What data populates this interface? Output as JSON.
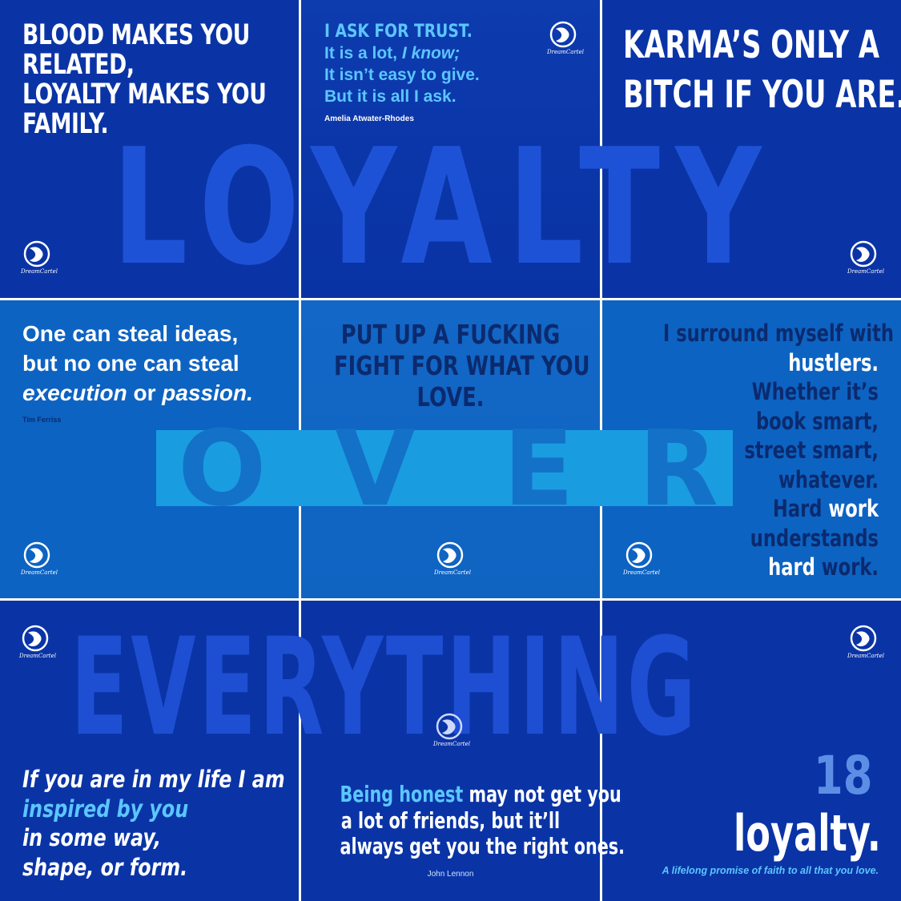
{
  "background": {
    "word_top": "LOYALTY",
    "word_middle": [
      "O",
      "V",
      "E",
      "R"
    ],
    "word_bottom": "EVERYTHING"
  },
  "brand": {
    "logo_text": "DreamCartel"
  },
  "tiles": {
    "t1": {
      "lines": [
        "BLOOD MAKES YOU",
        "RELATED,",
        "LOYALTY MAKES YOU",
        "FAMILY."
      ]
    },
    "t2": {
      "heading": "I ASK FOR TRUST.",
      "line2_a": "It is a lot, ",
      "line2_b": "I know;",
      "line3": "It isn’t easy to give.",
      "line4": "But it is all I ask.",
      "author": "Amelia Atwater-Rhodes"
    },
    "t3": {
      "lines": [
        "KARMA’S ONLY A",
        "BITCH IF YOU ARE."
      ]
    },
    "t4": {
      "line1": "One can steal ideas,",
      "line2": "but no one can steal",
      "line3_a": "execution",
      "line3_b": " or ",
      "line3_c": "passion.",
      "author": "Tim Ferriss"
    },
    "t5": {
      "lines": [
        "PUT UP A FUCKING",
        "FIGHT FOR WHAT YOU",
        "LOVE."
      ]
    },
    "t6": {
      "lines": [
        "I surround myself with",
        "hustlers.",
        "Whether it’s",
        "book smart,",
        "street smart,",
        "whatever."
      ],
      "hw1_a": "Hard",
      "hw1_b": " work",
      "line8": "understands",
      "hw2_a": "hard",
      "hw2_b": " work."
    },
    "t7": {
      "line1": "If you are in my life I am",
      "line2": "inspired by you",
      "line3": "in some way,",
      "line4": "shape, or form."
    },
    "t8": {
      "line1_a": "Being honest",
      "line1_b": " may not get you",
      "line2": "a lot of friends, but it’ll",
      "line3": "always get you the right ones.",
      "author": "John Lennon"
    },
    "t9": {
      "number": "18",
      "word": "loyalty.",
      "tagline": "A lifelong promise of faith to all that you love."
    }
  },
  "colors": {
    "dark_blue": "#0a34a6",
    "mid_blue": "#0d63c2",
    "light_blue_text": "#5cc6ff",
    "navy_text": "#0b2a6e",
    "watermark_blue": "#1e52d6"
  }
}
